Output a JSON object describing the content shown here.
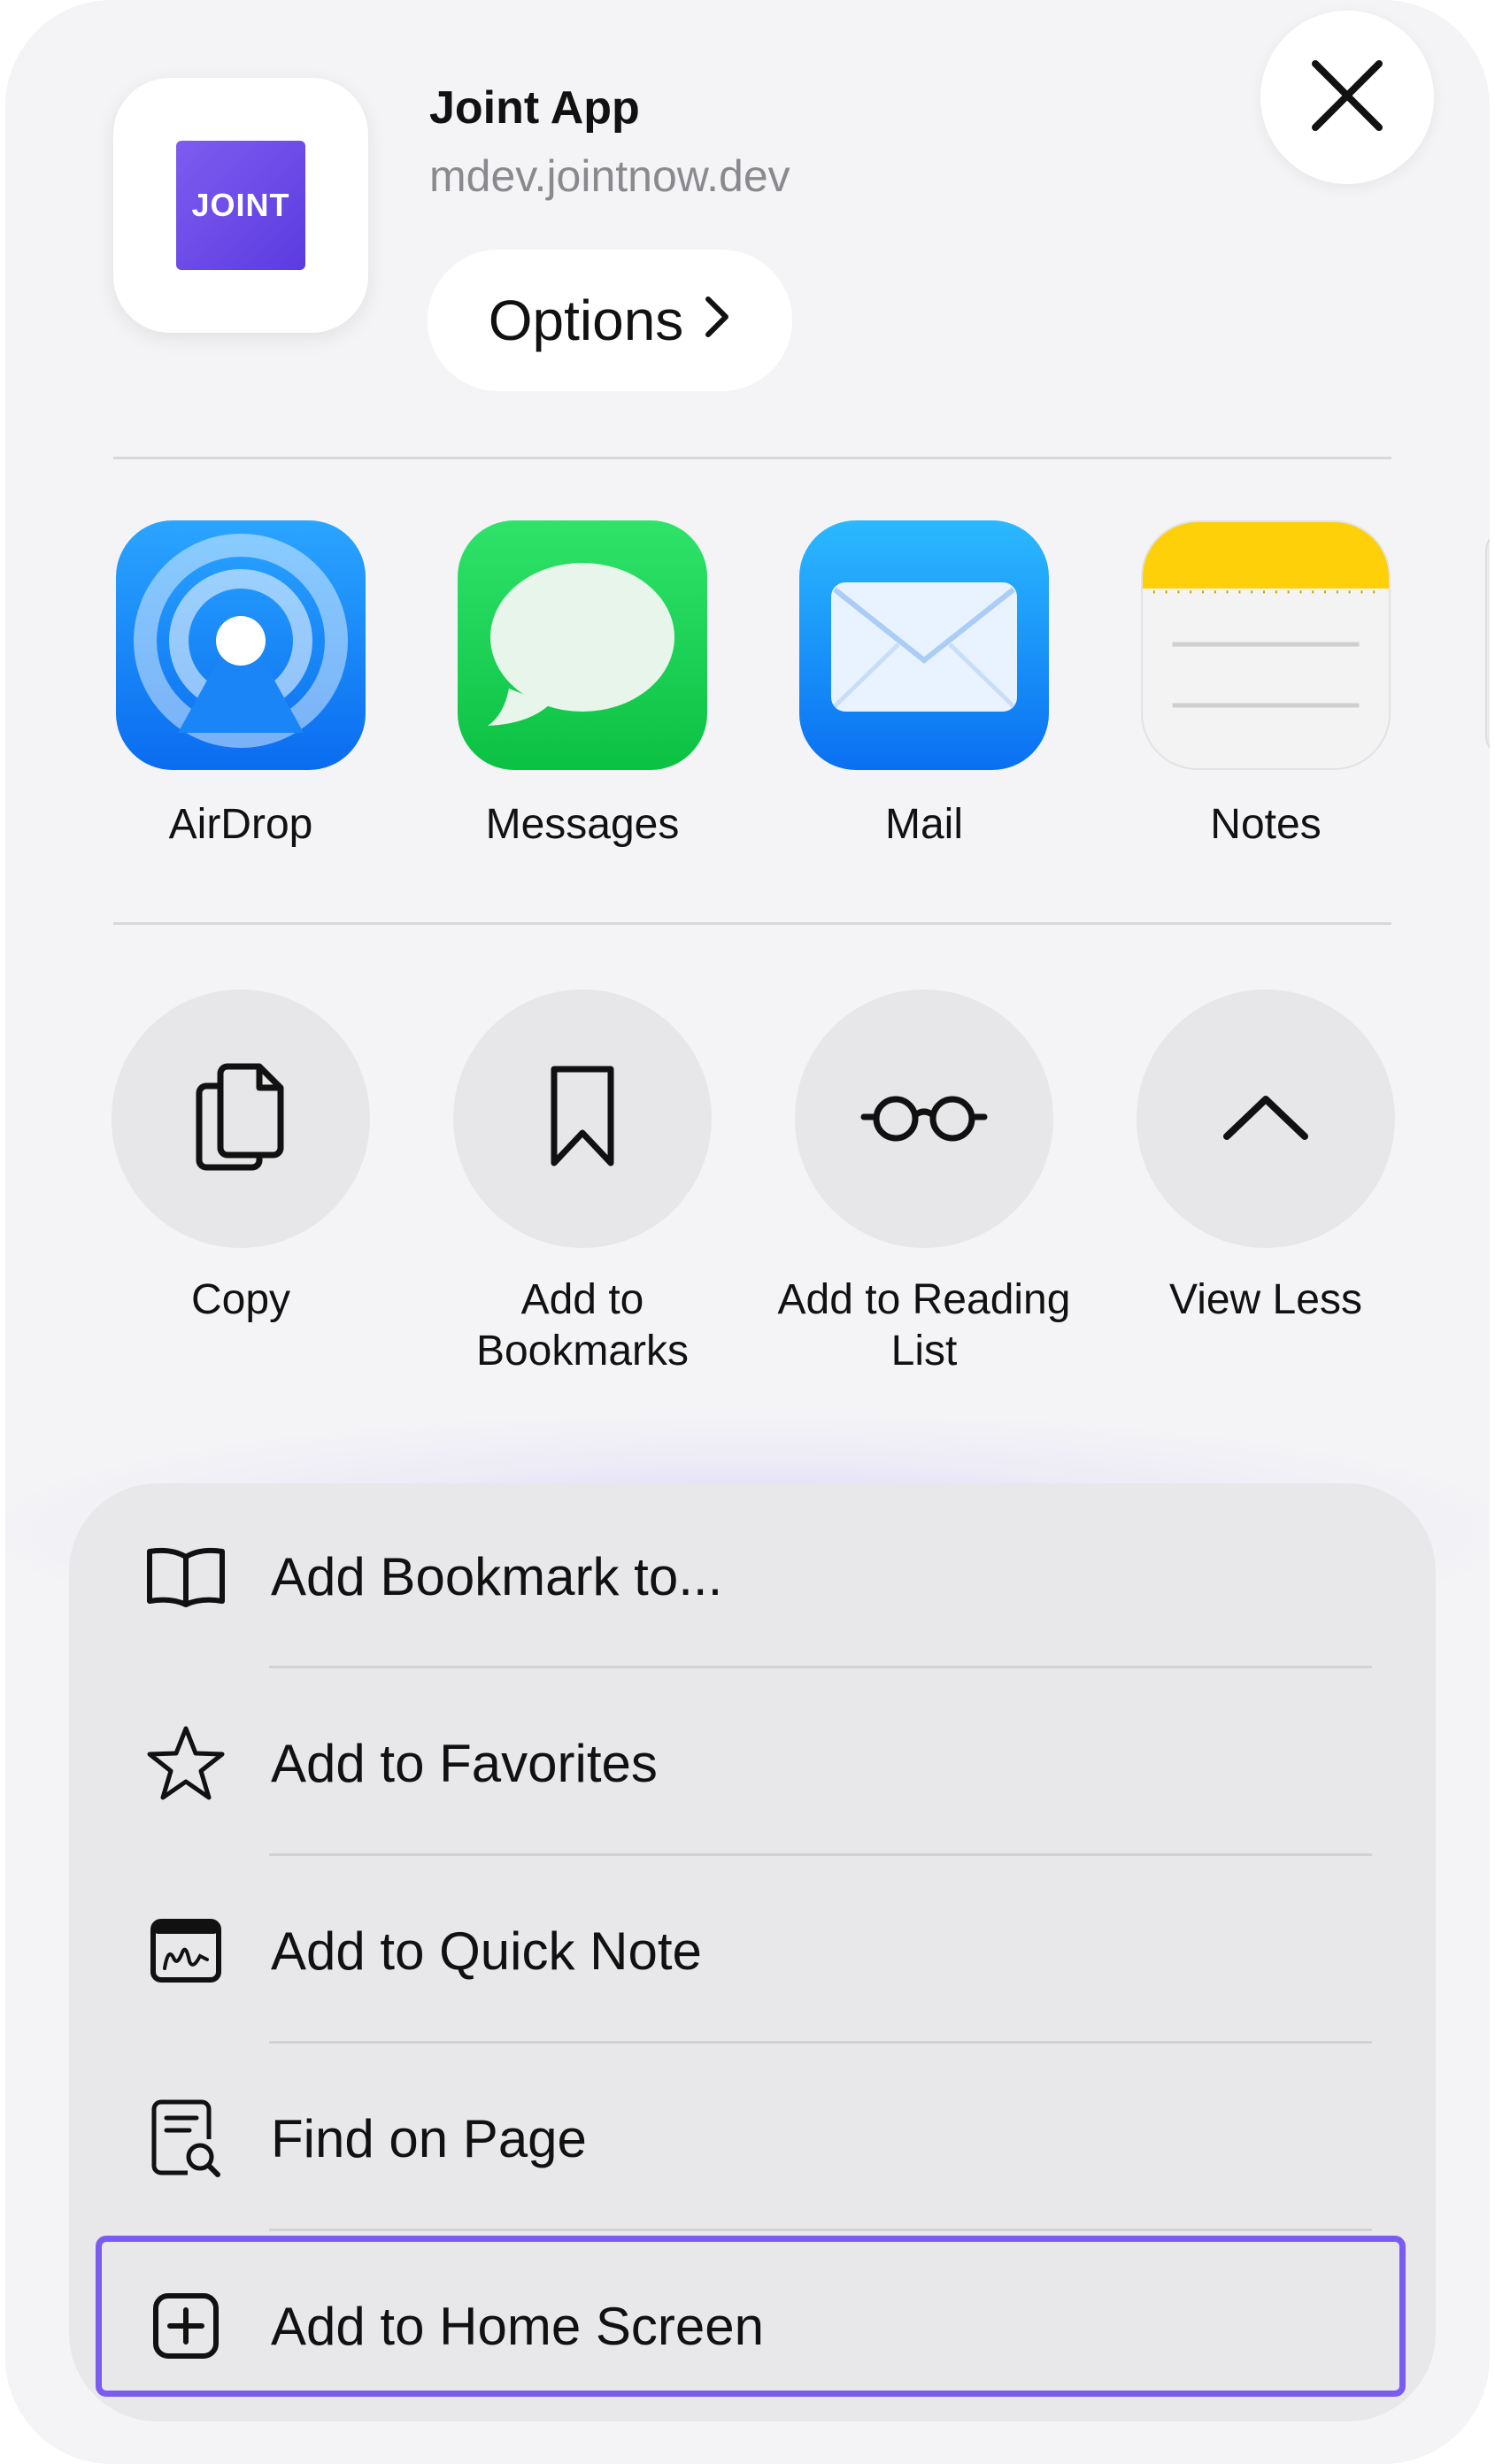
{
  "header": {
    "app_title": "Joint App",
    "app_url": "mdev.jointnow.dev",
    "logo_text": "JOINT",
    "options_label": "Options",
    "options_icon": "chevron-right-icon",
    "close_icon": "close-icon"
  },
  "share_targets": [
    {
      "label": "AirDrop",
      "icon": "airdrop-icon"
    },
    {
      "label": "Messages",
      "icon": "messages-icon"
    },
    {
      "label": "Mail",
      "icon": "mail-icon"
    },
    {
      "label": "Notes",
      "icon": "notes-icon"
    }
  ],
  "actions": [
    {
      "label": "Copy",
      "icon": "copy-icon"
    },
    {
      "label": "Add to\nBookmarks",
      "icon": "bookmark-icon"
    },
    {
      "label": "Add to Reading\nList",
      "icon": "reading-glasses-icon"
    },
    {
      "label": "View Less",
      "icon": "chevron-up-icon"
    }
  ],
  "menu": [
    {
      "label": "Add Bookmark to...",
      "icon": "book-icon"
    },
    {
      "label": "Add to Favorites",
      "icon": "star-icon"
    },
    {
      "label": "Add to Quick Note",
      "icon": "quick-note-icon"
    },
    {
      "label": "Find on Page",
      "icon": "find-on-page-icon"
    },
    {
      "label": "Add to Home Screen",
      "icon": "add-square-icon"
    }
  ],
  "colors": {
    "highlight": "#7b5cf0",
    "brand": "#6a4ae8"
  }
}
